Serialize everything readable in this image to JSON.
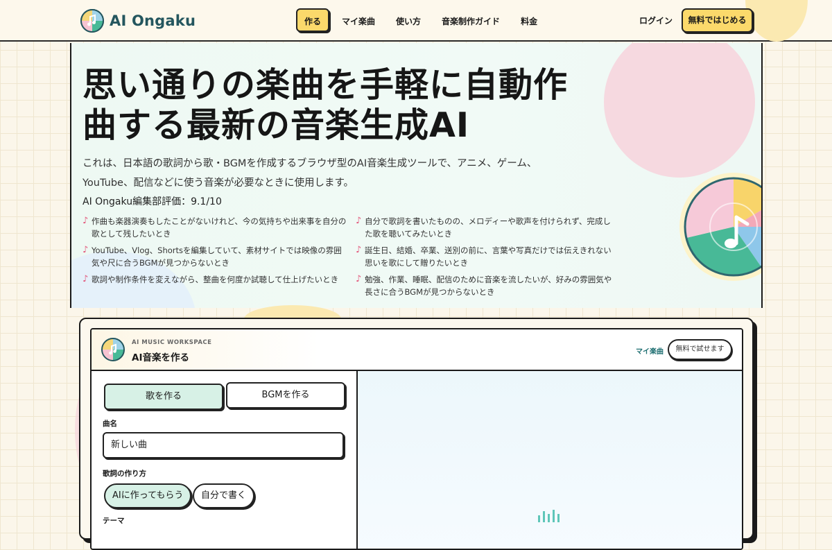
{
  "brand": {
    "name": "AI Ongaku"
  },
  "nav": {
    "items": [
      "作る",
      "マイ楽曲",
      "使い方",
      "音楽制作ガイド",
      "料金"
    ],
    "active_index": 0,
    "login": "ログイン",
    "cta": "無料ではじめる"
  },
  "hero": {
    "title_line1": "思い通りの楽曲を手軽に自動作",
    "title_line2": "曲する最新の音楽生成AI",
    "description": "これは、日本語の歌詞から歌・BGMを作成するブラウザ型のAI音楽生成ツールで、アニメ、ゲーム、YouTube、配信などに使う音楽が必要なときに使用します。",
    "rating": "AI Ongaku編集部評価：9.1/10",
    "bullets": [
      "作曲も楽器演奏もしたことがないけれど、今の気持ちや出来事を自分の歌として残したいとき",
      "自分で歌詞を書いたものの、メロディーや歌声を付けられず、完成した歌を聴いてみたいとき",
      "YouTube、Vlog、Shortsを編集していて、素材サイトでは映像の雰囲気や尺に合うBGMが見つからないとき",
      "誕生日、結婚、卒業、送別の前に、言葉や写真だけでは伝えきれない思いを歌にして贈りたいとき",
      "歌詞や制作条件を変えながら、整曲を何度か試聴して仕上げたいとき",
      "勉強、作業、睡眠、配信のために音楽を流したいが、好みの雰囲気や長さに合うBGMが見つからないとき"
    ],
    "bullet_icon": "music-note-icon"
  },
  "workspace": {
    "kicker": "AI MUSIC WORKSPACE",
    "title": "AI音楽を作る",
    "my_songs_link": "マイ楽曲",
    "try_button": "無料で試せます",
    "modes": [
      "歌を作る",
      "BGMを作る"
    ],
    "active_mode": 0,
    "song_name_label": "曲名",
    "song_name_value": "新しい曲",
    "lyrics_label": "歌詞の作り方",
    "lyrics_options": [
      "AIに作ってもらう",
      "自分で書く"
    ],
    "active_lyrics_option": 0,
    "theme_label": "テーマ"
  },
  "colors": {
    "accent_yellow": "#fbd96b",
    "brand_teal": "#24565e",
    "selected_mint": "#d7f1e6",
    "note_pink": "#e2567a",
    "link_teal": "#1f6f72"
  }
}
